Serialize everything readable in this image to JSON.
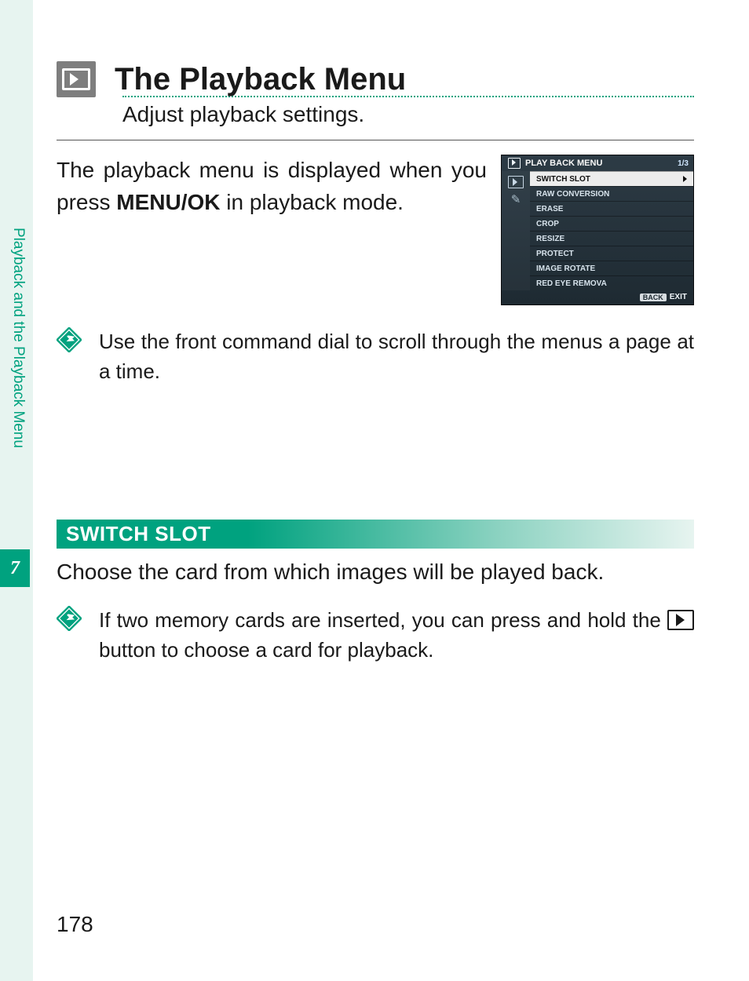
{
  "chapter": {
    "number": "7",
    "vertical_label": "Playback and the Playback Menu"
  },
  "title": "The Playback Menu",
  "subtitle": "Adjust playback settings.",
  "intro": {
    "part1": "The playback menu is displayed when you press ",
    "keycap": "MENU/OK",
    "part2": " in playback mode."
  },
  "lcd": {
    "title": "PLAY BACK MENU",
    "page": "1/3",
    "selected_index": 0,
    "items": [
      "SWITCH SLOT",
      "RAW CONVERSION",
      "ERASE",
      "CROP",
      "RESIZE",
      "PROTECT",
      "IMAGE ROTATE",
      "RED EYE REMOVA"
    ],
    "back_label": "BACK",
    "exit_label": "EXIT"
  },
  "note1": "Use the front command dial to scroll through the menus a page at a time.",
  "section_header": "SWITCH SLOT",
  "section_body": "Choose the card from which images will be played back.",
  "note2": {
    "part1": "If two memory cards are inserted, you can press and hold the ",
    "part2": " button to choose a card for playback."
  },
  "page_number": "178"
}
